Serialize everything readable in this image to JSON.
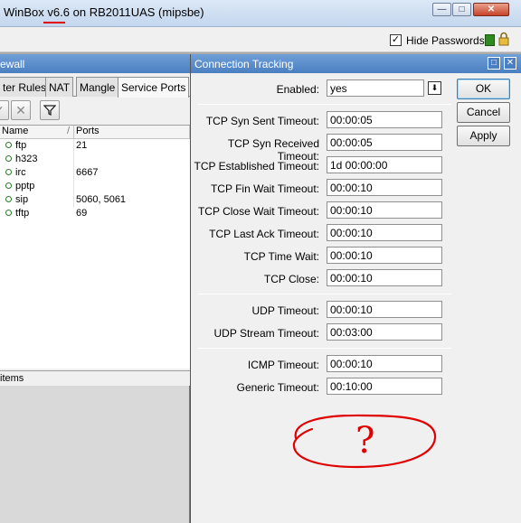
{
  "window": {
    "title_prefix": "WinBox",
    "title_version": "v6.6",
    "title_suffix": "on RB2011UAS (mipsbe)"
  },
  "toolbar": {
    "hide_passwords_label": "Hide Passwords",
    "hide_passwords_checked": true
  },
  "firewall": {
    "title": "ewall",
    "tabs": [
      "ter Rules",
      "NAT",
      "Mangle",
      "Service Ports"
    ],
    "active_tab": "Service Ports",
    "columns": [
      "Name",
      "Ports"
    ],
    "rows": [
      {
        "name": "ftp",
        "ports": "21"
      },
      {
        "name": "h323",
        "ports": ""
      },
      {
        "name": "irc",
        "ports": "6667"
      },
      {
        "name": "pptp",
        "ports": ""
      },
      {
        "name": "sip",
        "ports": "5060, 5061"
      },
      {
        "name": "tftp",
        "ports": "69"
      }
    ],
    "status": "items"
  },
  "conn_tracking": {
    "title": "Connection Tracking",
    "enabled": {
      "label": "Enabled:",
      "value": "yes"
    },
    "tcp": [
      {
        "label": "TCP Syn Sent Timeout:",
        "value": "00:00:05"
      },
      {
        "label": "TCP Syn Received Timeout:",
        "value": "00:00:05"
      },
      {
        "label": "TCP Established Timeout:",
        "value": "1d 00:00:00"
      },
      {
        "label": "TCP Fin Wait Timeout:",
        "value": "00:00:10"
      },
      {
        "label": "TCP Close Wait Timeout:",
        "value": "00:00:10"
      },
      {
        "label": "TCP Last Ack Timeout:",
        "value": "00:00:10"
      },
      {
        "label": "TCP Time Wait:",
        "value": "00:00:10"
      },
      {
        "label": "TCP Close:",
        "value": "00:00:10"
      }
    ],
    "udp": [
      {
        "label": "UDP Timeout:",
        "value": "00:00:10"
      },
      {
        "label": "UDP Stream Timeout:",
        "value": "00:03:00"
      }
    ],
    "other": [
      {
        "label": "ICMP Timeout:",
        "value": "00:00:10"
      },
      {
        "label": "Generic Timeout:",
        "value": "00:10:00"
      }
    ],
    "buttons": {
      "ok": "OK",
      "cancel": "Cancel",
      "apply": "Apply"
    }
  },
  "annotation": {
    "text": "?",
    "color": "#e00000"
  }
}
